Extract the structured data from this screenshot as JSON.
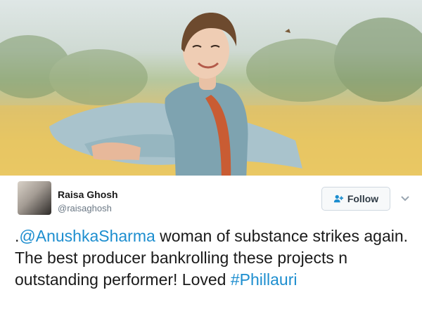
{
  "tweet": {
    "author_name": "Raisa Ghosh",
    "author_handle": "@raisaghosh",
    "follow_label": "Follow",
    "text_prefix": ".",
    "mention": "@AnushkaSharma",
    "text_body": " woman of substance strikes again. The best producer bankrolling these projects n outstanding performer! Loved ",
    "hashtag": "#Phillauri"
  },
  "colors": {
    "link": "#1d8ecf",
    "text": "#1a1a1a",
    "muted": "#6a7784"
  },
  "icons": {
    "follow": "add-user-icon",
    "menu": "chevron-down-icon"
  }
}
